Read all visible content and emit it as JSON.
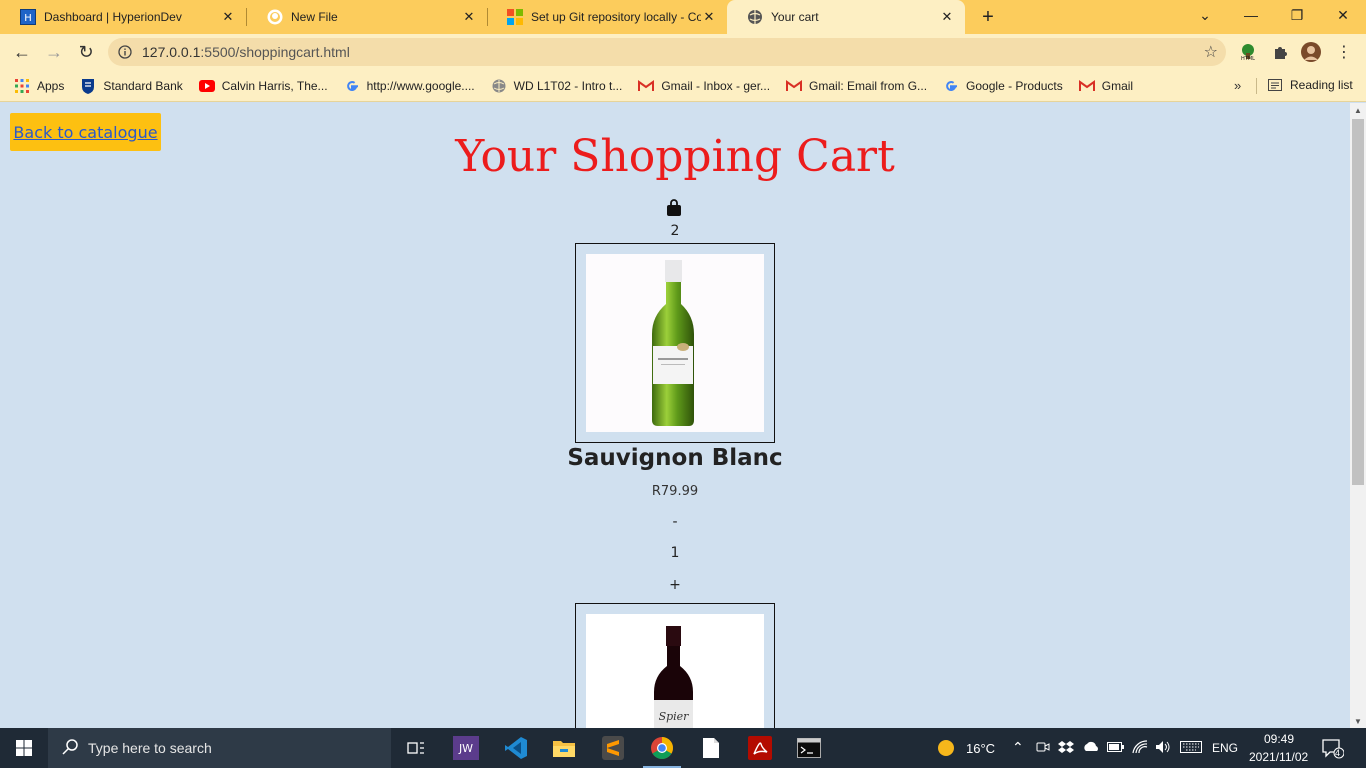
{
  "browser": {
    "tabs": [
      {
        "title": "Dashboard | HyperionDev",
        "icon": "hyperiondev-icon"
      },
      {
        "title": "New File",
        "icon": "github-icon"
      },
      {
        "title": "Set up Git repository locally - Co",
        "icon": "microsoft-icon"
      },
      {
        "title": "Your cart",
        "icon": "globe-icon",
        "active": true
      }
    ],
    "address": {
      "host": "127.0.0.1",
      "path": ":5500/shoppingcart.html"
    },
    "bookmarks": [
      {
        "label": "Apps",
        "icon": "apps-grid-icon"
      },
      {
        "label": "Standard Bank",
        "icon": "standard-bank-icon"
      },
      {
        "label": "Calvin Harris, The...",
        "icon": "youtube-icon"
      },
      {
        "label": "http://www.google....",
        "icon": "google-icon"
      },
      {
        "label": "WD L1T02 - Intro t...",
        "icon": "globe-icon"
      },
      {
        "label": "Gmail - Inbox - ger...",
        "icon": "gmail-icon"
      },
      {
        "label": "Gmail: Email from G...",
        "icon": "gmail-icon"
      },
      {
        "label": "Google - Products",
        "icon": "google-icon"
      },
      {
        "label": "Gmail",
        "icon": "gmail-icon"
      }
    ],
    "reading_list": "Reading list"
  },
  "page": {
    "back_link": "Back to catalogue",
    "title": "Your Shopping Cart",
    "cart_count": "2",
    "items": [
      {
        "name": "Sauvignon Blanc",
        "price": "R79.99",
        "minus": "-",
        "quantity": "1",
        "plus": "+",
        "bottle": "white-wine"
      },
      {
        "bottle": "red-wine",
        "label_text": "Spier"
      }
    ]
  },
  "taskbar": {
    "search_placeholder": "Type here to search",
    "weather": "16°C",
    "language": "ENG",
    "time": "09:49",
    "date": "2021/11/02",
    "notifications": "4"
  },
  "colors": {
    "tab_strip": "#fccc5c",
    "page_bg": "#d0e0ef",
    "title_red": "#ec1c1c",
    "back_button": "#fdc011"
  }
}
